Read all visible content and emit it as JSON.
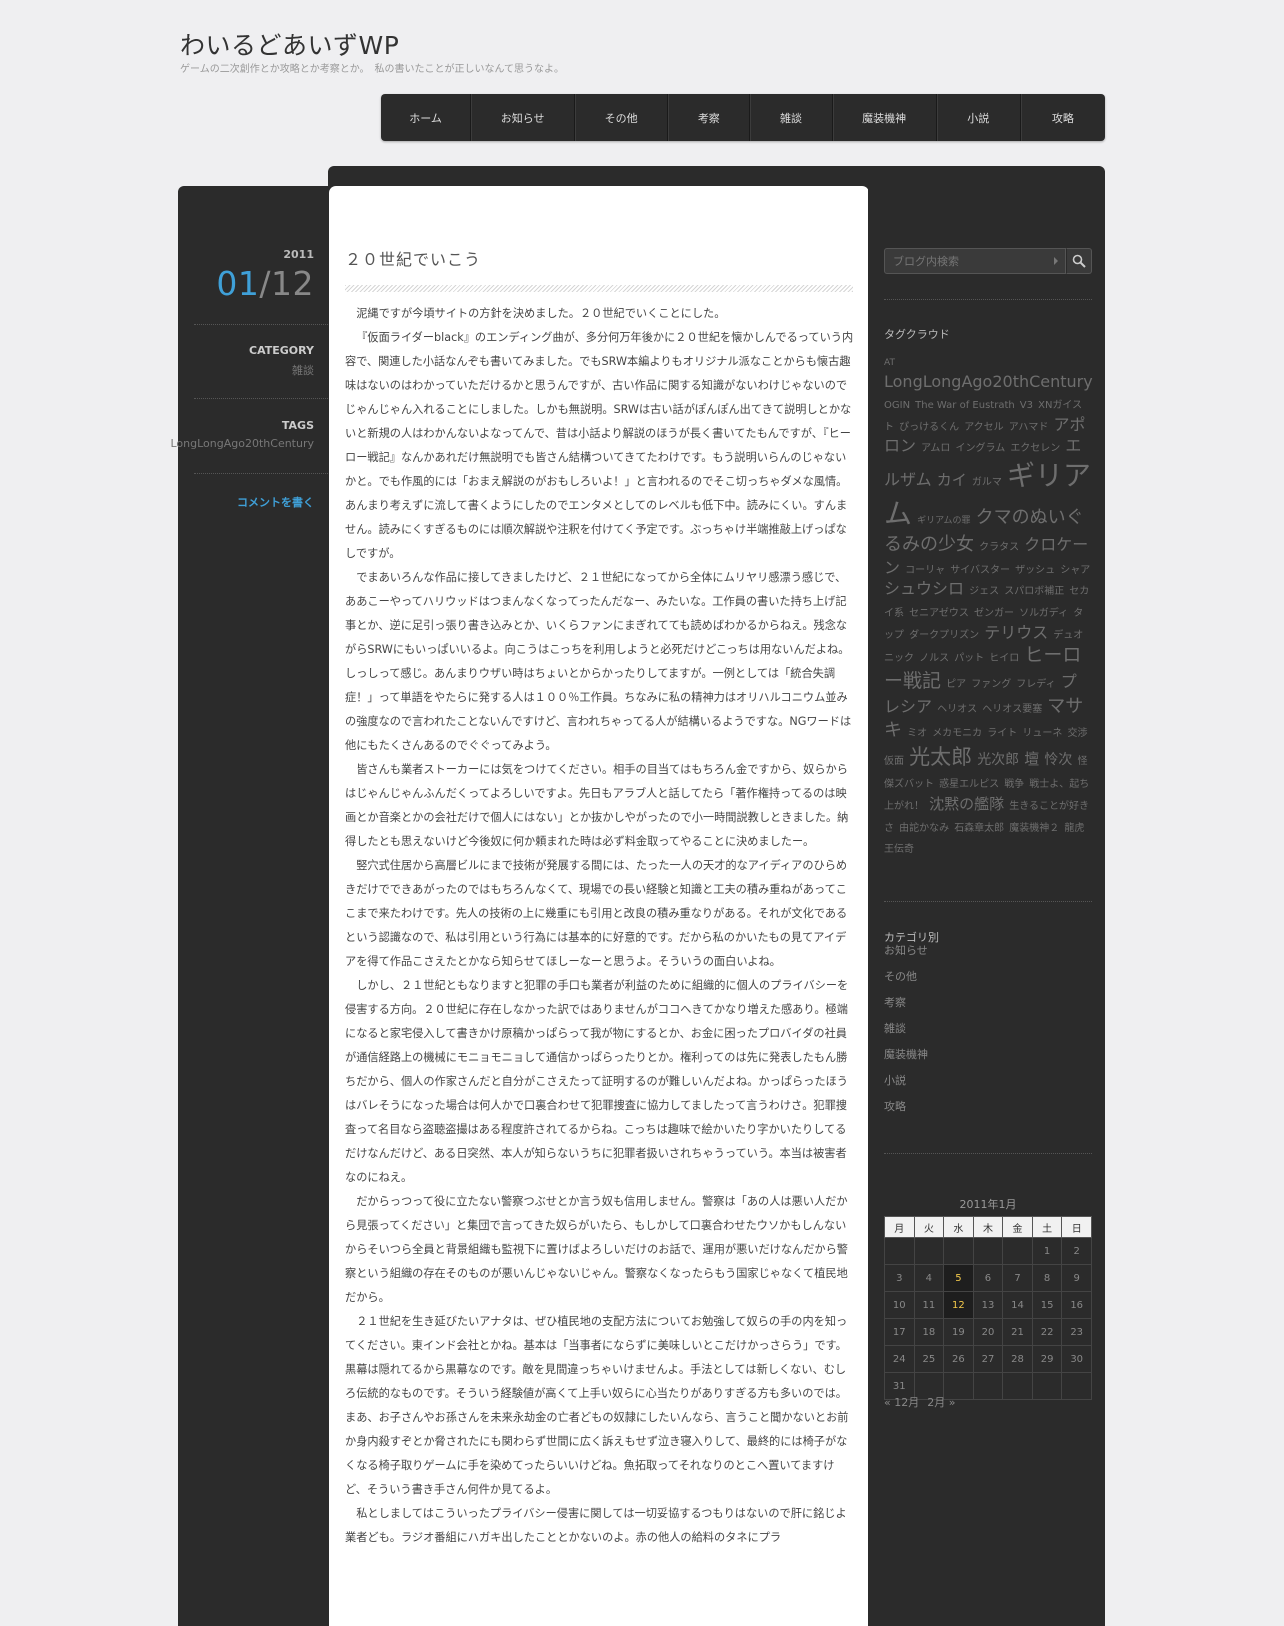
{
  "site": {
    "title": "わいるどあいずWP",
    "description": "ゲームの二次創作とか攻略とか考察とか。　私の書いたことが正しいなんて思うなよ。"
  },
  "nav": [
    "ホーム",
    "お知らせ",
    "その他",
    "考察",
    "雑談",
    "魔装機神",
    "小説",
    "攻略"
  ],
  "post_meta": {
    "year": "2011",
    "month": "01",
    "day": "/12",
    "category_label": "CATEGORY",
    "category": "雑談",
    "tags_label": "TAGS",
    "tags": "LongLongAgo20thCentury",
    "comment_link": "コメントを書く"
  },
  "post": {
    "title": "２０世紀でいこう",
    "paragraphs": [
      "泥縄ですが今頃サイトの方針を決めました。２０世紀でいくことにした。",
      "『仮面ライダーblack』のエンディング曲が、多分何万年後かに２０世紀を懐かしんでるっていう内容で、関連した小話なんぞも書いてみました。でもSRW本編よりもオリジナル派なことからも懐古趣味はないのはわかっていただけるかと思うんですが、古い作品に関する知識がないわけじゃないのでじゃんじゃん入れることにしました。しかも無説明。SRWは古い話がぽんぽん出てきて説明しとかないと新規の人はわかんないよなってんで、昔は小話より解説のほうが長く書いてたもんですが、『ヒーロー戦記』なんかあれだけ無説明でも皆さん結構ついてきてたわけです。もう説明いらんのじゃないかと。でも作風的には「おまえ解説のがおもしろいよ！」と言われるのでそこ切っちゃダメな風情。あんまり考えずに流して書くようにしたのでエンタメとしてのレベルも低下中。読みにくい。すんません。読みにくすぎるものには順次解説や注釈を付けてく予定です。ぶっちゃけ半端推敲上げっぱなしですが。",
      "でまあいろんな作品に接してきましたけど、２１世紀になってから全体にムリヤリ感漂う感じで、ああこーやってハリウッドはつまんなくなってったんだなー、みたいな。工作員の書いた持ち上げ記事とか、逆に足引っ張り書き込みとか、いくらファンにまぎれてても読めばわかるからねえ。残念ながらSRWにもいっぱいいるよ。向こうはこっちを利用しようと必死だけどこっちは用ないんだよね。しっしって感じ。あんまりウザい時はちょいとからかったりしてますが。一例としては「統合失調症！」って単語をやたらに発する人は１００％工作員。ちなみに私の精神力はオリハルコニウム並みの強度なので言われたことないんですけど、言われちゃってる人が結構いるようですな。NGワードは他にもたくさんあるのでぐぐってみよう。",
      "皆さんも業者ストーカーには気をつけてください。相手の目当てはもちろん金ですから、奴らからはじゃんじゃんふんだくってよろしいですよ。先日もアラブ人と話してたら「著作権持ってるのは映画とか音楽とかの会社だけで個人にはない」とか抜かしやがったので小一時間説教しときました。納得したとも思えないけど今後奴に何か頼まれた時は必ず料金取ってやることに決めましたー。",
      "竪穴式住居から高層ビルにまで技術が発展する間には、たった一人の天才的なアイディアのひらめきだけでできあがったのではもちろんなくて、現場での長い経験と知識と工夫の積み重ねがあってここまで来たわけです。先人の技術の上に幾重にも引用と改良の積み重なりがある。それが文化であるという認識なので、私は引用という行為には基本的に好意的です。だから私のかいたもの見てアイデアを得て作品こさえたとかなら知らせてほしーなーと思うよ。そういうの面白いよね。",
      "しかし、２１世紀ともなりますと犯罪の手口も業者が利益のために組織的に個人のプライバシーを侵害する方向。２０世紀に存在しなかった訳ではありませんがココへきてかなり増えた感あり。極端になると家宅侵入して書きかけ原稿かっぱらって我が物にするとか、お金に困ったプロバイダの社員が通信経路上の機械にモニョモニョして通信かっぱらったりとか。権利ってのは先に発表したもん勝ちだから、個人の作家さんだと自分がこさえたって証明するのが難しいんだよね。かっぱらったほうはバレそうになった場合は何人かで口裏合わせて犯罪捜査に協力してましたって言うわけさ。犯罪捜査って名目なら盗聴盗撮はある程度許されてるからね。こっちは趣味で絵かいたり字かいたりしてるだけなんだけど、ある日突然、本人が知らないうちに犯罪者扱いされちゃうっていう。本当は被害者なのにねえ。",
      "だからっつって役に立たない警察つぶせとか言う奴も信用しません。警察は「あの人は悪い人だから見張ってください」と集団で言ってきた奴らがいたら、もしかして口裏合わせたウソかもしんないからそいつら全員と背景組織も監視下に置けばよろしいだけのお話で、運用が悪いだけなんだから警察という組織の存在そのものが悪いんじゃないじゃん。警察なくなったらもう国家じゃなくて植民地だから。",
      "２１世紀を生き延びたいアナタは、ぜひ植民地の支配方法についてお勉強して奴らの手の内を知ってください。東インド会社とかね。基本は「当事者にならずに美味しいとこだけかっさらう」です。黒幕は隠れてるから黒幕なのです。敵を見間違っちゃいけませんよ。手法としては新しくない、むしろ伝統的なものです。そういう経験値が高くて上手い奴らに心当たりがありすぎる方も多いのでは。まあ、お子さんやお孫さんを未来永劫金の亡者どもの奴隷にしたいんなら、言うこと聞かないとお前か身内殺すぞとか脅されたにも関わらず世間に広く訴えもせず泣き寝入りして、最終的には椅子がなくなる椅子取りゲームに手を染めてったらいいけどね。魚拓取ってそれなりのとこへ置いてますけど、そういう書き手さん何件か見てるよ。",
      "私としましてはこういったプライバシー侵害に関しては一切妥協するつもりはないので肝に銘じよ業者ども。ラジオ番組にハガキ出したこととかないのよ。赤の他人の給料のタネにプラ"
    ]
  },
  "sidebar": {
    "search_placeholder": "ブログ内検索",
    "tagcloud_title": "タグクラウド",
    "tags": [
      {
        "t": "AT",
        "s": 9
      },
      {
        "t": "LongLongAgo20thCentury",
        "s": 16
      },
      {
        "t": "OGIN",
        "s": 10
      },
      {
        "t": "The War of Eustrath",
        "s": 10
      },
      {
        "t": "V3",
        "s": 10
      },
      {
        "t": "XNガイスト",
        "s": 10
      },
      {
        "t": "ぴっけるくん",
        "s": 10
      },
      {
        "t": "アクセル",
        "s": 10
      },
      {
        "t": "アハマド",
        "s": 10
      },
      {
        "t": "アポロン",
        "s": 16
      },
      {
        "t": "アムロ",
        "s": 10
      },
      {
        "t": "イングラム",
        "s": 10
      },
      {
        "t": "エクセレン",
        "s": 10
      },
      {
        "t": "エルザム",
        "s": 16
      },
      {
        "t": "カイ",
        "s": 15
      },
      {
        "t": "ガルマ",
        "s": 10
      },
      {
        "t": "ギリアム",
        "s": 28
      },
      {
        "t": "ギリアムの罪",
        "s": 9
      },
      {
        "t": "クマのぬいぐるみの少女",
        "s": 18
      },
      {
        "t": "クラタス",
        "s": 10
      },
      {
        "t": "クロケーン",
        "s": 16
      },
      {
        "t": "コーリャ",
        "s": 10
      },
      {
        "t": "サイバスター",
        "s": 10
      },
      {
        "t": "ザッシュ",
        "s": 10
      },
      {
        "t": "シャア",
        "s": 10
      },
      {
        "t": "シュウシロ",
        "s": 16
      },
      {
        "t": "ジェス",
        "s": 10
      },
      {
        "t": "スパロボ補正",
        "s": 10
      },
      {
        "t": "セカイ系",
        "s": 10
      },
      {
        "t": "セニアゼウス",
        "s": 10
      },
      {
        "t": "ゼンガー",
        "s": 10
      },
      {
        "t": "ソルガディ",
        "s": 10
      },
      {
        "t": "タップ",
        "s": 10
      },
      {
        "t": "ダークプリズン",
        "s": 10
      },
      {
        "t": "テリウス",
        "s": 16
      },
      {
        "t": "デュオ",
        "s": 10
      },
      {
        "t": "ニック",
        "s": 10
      },
      {
        "t": "ノルス",
        "s": 10
      },
      {
        "t": "パット",
        "s": 10
      },
      {
        "t": "ヒイロ",
        "s": 10
      },
      {
        "t": "ヒーロー戦記",
        "s": 19
      },
      {
        "t": "ピア",
        "s": 10
      },
      {
        "t": "ファング",
        "s": 10
      },
      {
        "t": "フレディ",
        "s": 10
      },
      {
        "t": "プレシア",
        "s": 16
      },
      {
        "t": "ヘリオス",
        "s": 10
      },
      {
        "t": "ヘリオス要塞",
        "s": 10
      },
      {
        "t": "マサキ",
        "s": 18
      },
      {
        "t": "ミオ",
        "s": 10
      },
      {
        "t": "メカモニカ",
        "s": 10
      },
      {
        "t": "ライト",
        "s": 10
      },
      {
        "t": "リューネ",
        "s": 10
      },
      {
        "t": "交渉",
        "s": 10
      },
      {
        "t": "仮面",
        "s": 10
      },
      {
        "t": "光太郎",
        "s": 21
      },
      {
        "t": "光次郎",
        "s": 14
      },
      {
        "t": "壇",
        "s": 15
      },
      {
        "t": "怜次",
        "s": 14
      },
      {
        "t": "怪傑ズバット",
        "s": 10
      },
      {
        "t": "惑星エルピス",
        "s": 10
      },
      {
        "t": "戦争",
        "s": 10
      },
      {
        "t": "戦士よ、起ち上がれ！",
        "s": 10
      },
      {
        "t": "沈黙の艦隊",
        "s": 15
      },
      {
        "t": "生きることが好きさ",
        "s": 10
      },
      {
        "t": "由詑かなみ",
        "s": 10
      },
      {
        "t": "石森章太郎",
        "s": 10
      },
      {
        "t": "魔装機神２",
        "s": 10
      },
      {
        "t": "龍虎王伝奇",
        "s": 10
      }
    ],
    "category_title": "カテゴリ別",
    "categories": [
      "お知らせ",
      "その他",
      "考察",
      "雑談",
      "魔装機神",
      "小説",
      "攻略"
    ],
    "calendar": {
      "caption": "2011年1月",
      "weekdays": [
        "月",
        "火",
        "水",
        "木",
        "金",
        "土",
        "日"
      ],
      "weeks": [
        [
          "",
          "",
          "",
          "",
          "",
          "1",
          "2"
        ],
        [
          "3",
          "4",
          "5",
          "6",
          "7",
          "8",
          "9"
        ],
        [
          "10",
          "11",
          "12",
          "13",
          "14",
          "15",
          "16"
        ],
        [
          "17",
          "18",
          "19",
          "20",
          "21",
          "22",
          "23"
        ],
        [
          "24",
          "25",
          "26",
          "27",
          "28",
          "29",
          "30"
        ],
        [
          "31",
          "",
          "",
          "",
          "",
          "",
          ""
        ]
      ],
      "linked_days": [
        "5",
        "12"
      ],
      "prev": "« 12月",
      "next": "2月 »"
    }
  },
  "colors": {
    "page_bg": "#efeff1",
    "panel_dark": "#2b2b2b",
    "accent_blue": "#3fa0d8",
    "calendar_link": "#f2c84b"
  }
}
